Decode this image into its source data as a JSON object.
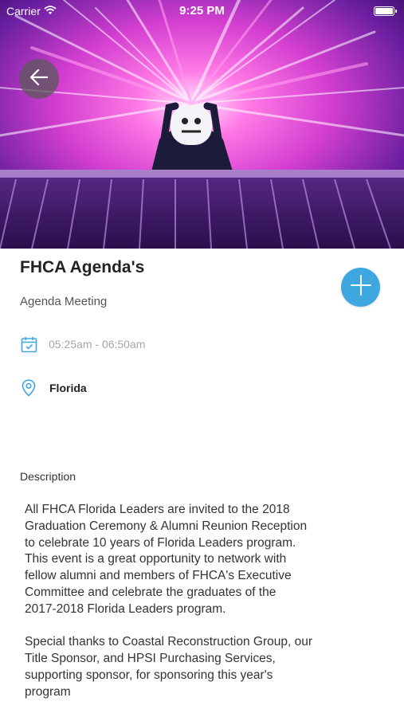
{
  "status_bar": {
    "carrier": "Carrier",
    "time": "9:25 PM"
  },
  "event": {
    "title": "FHCA Agenda's",
    "subtitle": "Agenda Meeting",
    "time_range": "05:25am - 06:50am",
    "location": "Florida"
  },
  "description": {
    "label": "Description",
    "paragraph1": "All FHCA Florida Leaders are invited to the 2018\nGraduation Ceremony & Alumni Reunion Reception\nto celebrate 10 years of Florida Leaders program.\nThis event is a great opportunity to network with\nfellow alumni and members of FHCA's Executive\nCommittee and celebrate the graduates of the\n2017-2018  Florida Leaders program.",
    "paragraph2": "Special thanks to Coastal Reconstruction Group, our\nTitle Sponsor, and HPSI Purchasing Services,\nsupporting sponsor, for sponsoring this year's\nprogram"
  },
  "icons": {
    "back": "arrow-left-icon",
    "add": "plus-icon",
    "calendar": "calendar-check-icon",
    "location": "map-pin-icon",
    "wifi": "wifi-icon",
    "battery": "battery-icon"
  },
  "colors": {
    "accent": "#3ea7e0",
    "muted_text": "#a6a6a6",
    "hero_pink": "#ff3fd0",
    "hero_purple": "#5a1a9a"
  }
}
